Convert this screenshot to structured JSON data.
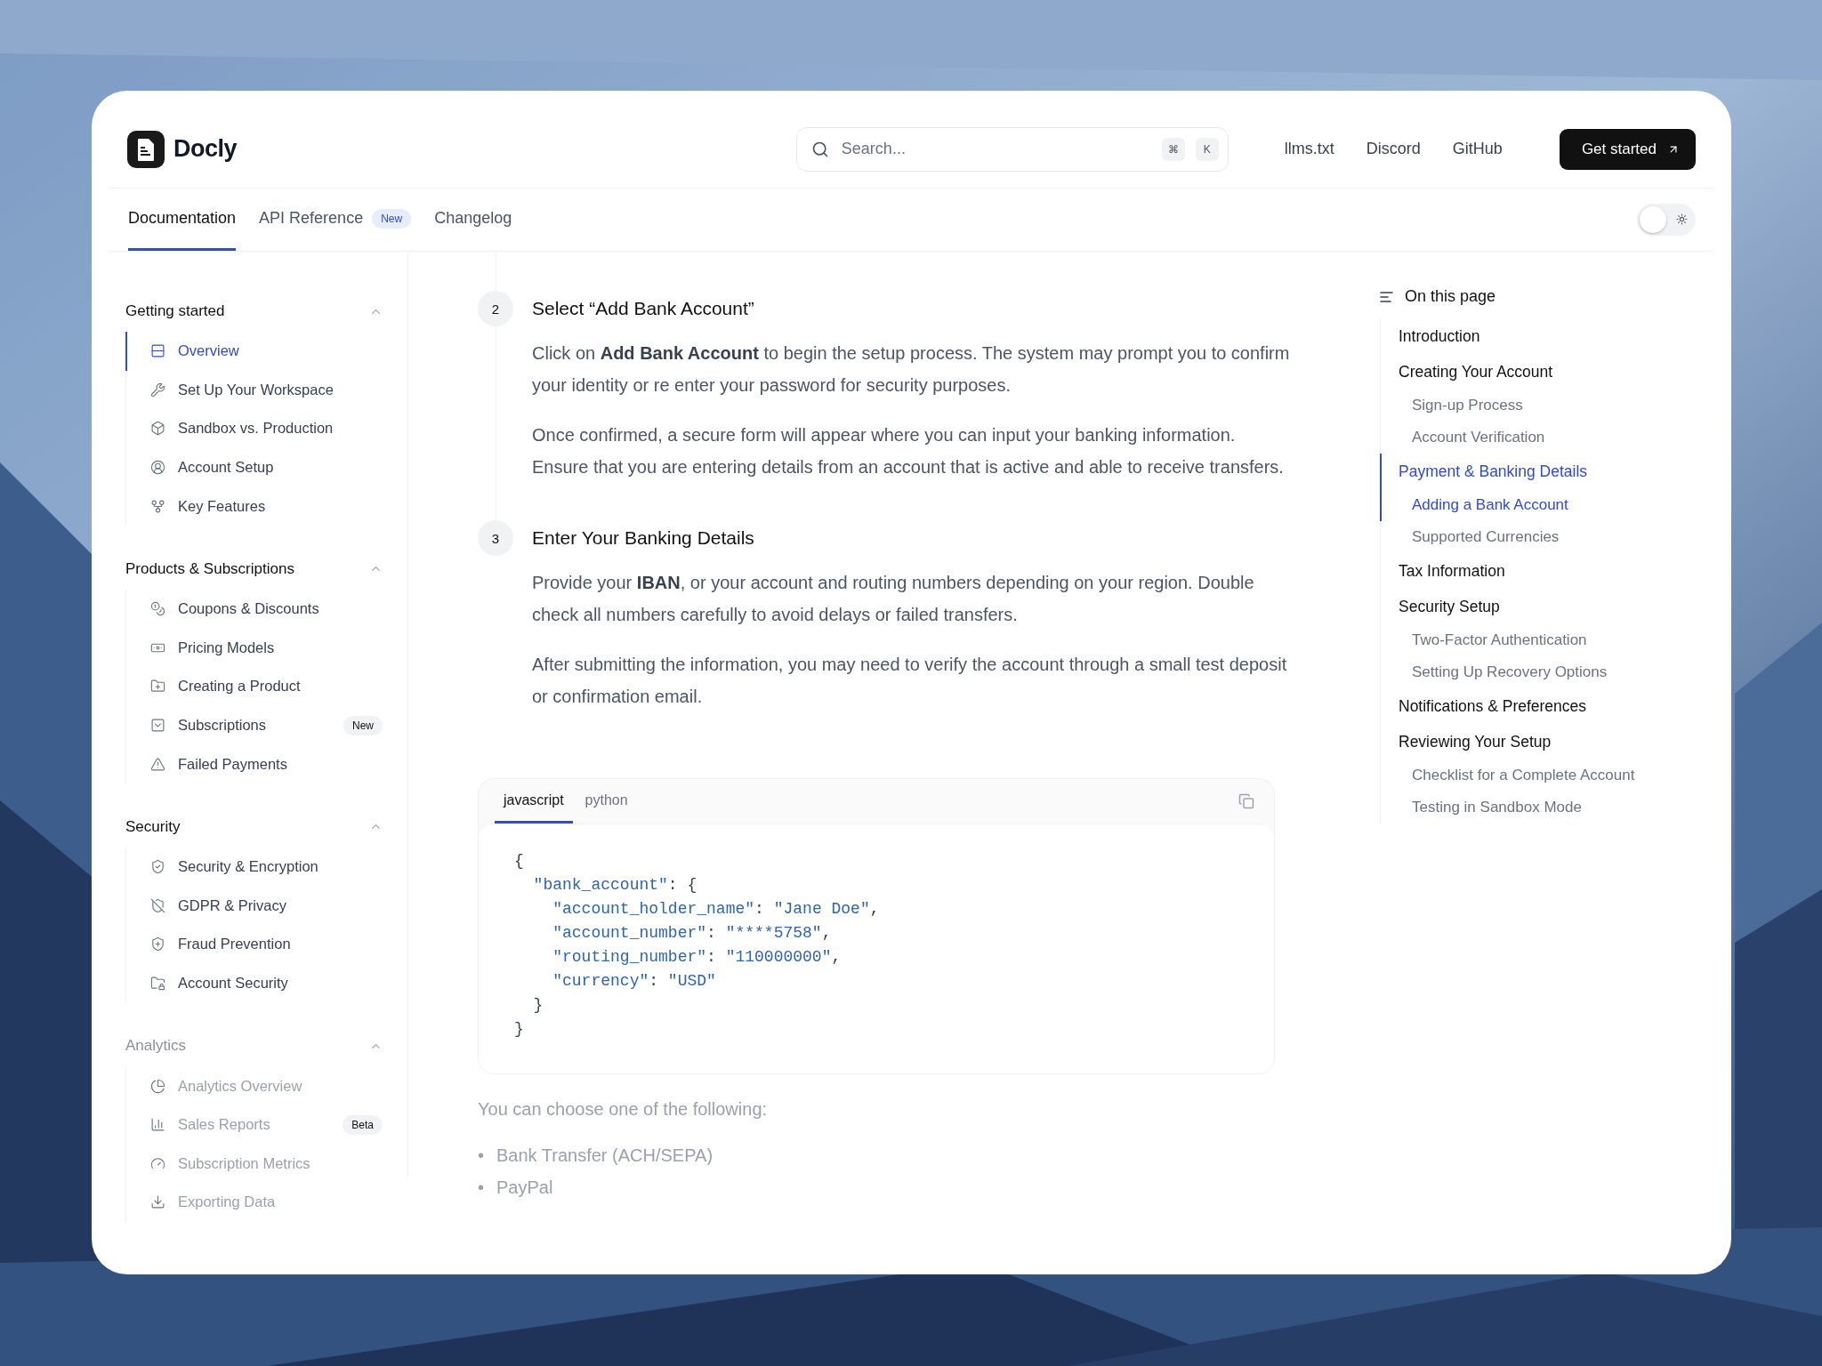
{
  "header": {
    "logo": {
      "name": "Docly"
    },
    "search": {
      "placeholder": "Search...",
      "shortcut": [
        "⌘",
        "K"
      ]
    },
    "links": [
      "llms.txt",
      "Discord",
      "GitHub"
    ],
    "cta": "Get started"
  },
  "tabs": [
    {
      "label": "Documentation",
      "selected": true
    },
    {
      "label": "API Reference",
      "selected": false,
      "badge": "New"
    },
    {
      "label": "Changelog",
      "selected": false
    }
  ],
  "theme_toggle": {
    "on": false
  },
  "sidebar": {
    "groups": [
      {
        "title": "Getting started",
        "expanded": true,
        "items": [
          {
            "label": "Overview",
            "selected": true
          },
          {
            "label": "Set Up Your Workspace",
            "selected": false
          },
          {
            "label": "Sandbox vs. Production",
            "selected": false
          },
          {
            "label": "Account Setup",
            "selected": false
          },
          {
            "label": "Key Features",
            "selected": false
          }
        ]
      },
      {
        "title": "Products & Subscriptions",
        "expanded": true,
        "items": [
          {
            "label": "Coupons & Discounts",
            "selected": false
          },
          {
            "label": "Pricing Models",
            "selected": false
          },
          {
            "label": "Creating a Product",
            "selected": false
          },
          {
            "label": "Subscriptions",
            "selected": false,
            "badge": "New"
          },
          {
            "label": "Failed Payments",
            "selected": false
          }
        ]
      },
      {
        "title": "Security",
        "expanded": true,
        "items": [
          {
            "label": "Security & Encryption",
            "selected": false
          },
          {
            "label": "GDPR & Privacy",
            "selected": false
          },
          {
            "label": "Fraud Prevention",
            "selected": false
          },
          {
            "label": "Account Security",
            "selected": false
          }
        ]
      },
      {
        "title": "Analytics",
        "expanded": true,
        "faded": true,
        "items": [
          {
            "label": "Analytics Overview",
            "selected": false
          },
          {
            "label": "Sales Reports",
            "selected": false,
            "badge": "Beta"
          },
          {
            "label": "Subscription Metrics",
            "selected": false
          },
          {
            "label": "Exporting Data",
            "selected": false
          }
        ]
      }
    ]
  },
  "content": {
    "steps": [
      {
        "number": "2",
        "title": "Select “Add Bank Account”",
        "paragraphs": [
          "Click on **Add Bank Account** to begin the setup process. The system may prompt you to confirm your identity or re enter your password for security purposes.",
          "Once confirmed, a secure form will appear where you can input your banking information. Ensure that you are entering details from an account that is active and able to receive transfers."
        ]
      },
      {
        "number": "3",
        "title": "Enter Your Banking Details",
        "paragraphs": [
          "Provide your **IBAN**, or your account and routing numbers depending on your region. Double check all numbers carefully to avoid delays or failed transfers.",
          "After submitting the information, you may need to verify the account through a small test deposit or confirmation email."
        ]
      }
    ],
    "code_block": {
      "tabs": [
        {
          "label": "javascript",
          "selected": true
        },
        {
          "label": "python",
          "selected": false
        }
      ],
      "lines": [
        "{",
        "  \"bank_account\": {",
        "    \"account_holder_name\": \"Jane Doe\",",
        "    \"account_number\": \"****5758\",",
        "    \"routing_number\": \"110000000\",",
        "    \"currency\": \"USD\"",
        "  }",
        "}"
      ]
    },
    "after": {
      "faded": true,
      "text": "You can choose one of the following:",
      "bullets": [
        {
          "marker": "•",
          "text": "Bank Transfer (ACH/SEPA)"
        },
        {
          "marker": "•",
          "text": "PayPal"
        }
      ]
    }
  },
  "toc": {
    "title": "On this page",
    "items": [
      {
        "label": "Introduction",
        "active": false
      },
      {
        "label": "Creating Your Account",
        "active": false,
        "children": [
          {
            "label": "Sign-up Process",
            "active": false
          },
          {
            "label": "Account Verification",
            "active": false
          }
        ]
      },
      {
        "label": "Payment & Banking Details",
        "active": true,
        "children": [
          {
            "label": "Adding a Bank Account",
            "active": true
          },
          {
            "label": "Supported Currencies",
            "active": false
          }
        ]
      },
      {
        "label": "Tax Information",
        "active": false
      },
      {
        "label": "Security Setup",
        "active": false,
        "children": [
          {
            "label": "Two-Factor Authentication",
            "active": false
          },
          {
            "label": "Setting Up Recovery Options",
            "active": false
          }
        ]
      },
      {
        "label": "Notifications & Preferences",
        "active": false
      },
      {
        "label": "Reviewing Your Setup",
        "active": false,
        "children": [
          {
            "label": "Checklist for a Complete Account",
            "active": false
          },
          {
            "label": "Testing in Sandbox Mode",
            "active": false
          }
        ]
      }
    ]
  }
}
